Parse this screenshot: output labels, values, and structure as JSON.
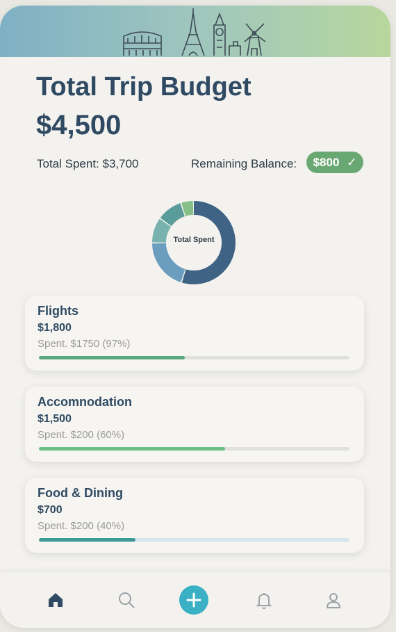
{
  "header": {
    "title": "Total Trip Budget",
    "total": "$4,500"
  },
  "summary": {
    "spent_text": "Total Spent: $3,700",
    "remaining_label": "Remaining Balance:",
    "remaining_value": "$800",
    "badge_color": "#6aa873"
  },
  "donut": {
    "label": "Total Spent",
    "segments": [
      {
        "fraction": 0.55,
        "color": "#3f6384"
      },
      {
        "fraction": 0.2,
        "color": "#6b9dbe"
      },
      {
        "fraction": 0.1,
        "color": "#78b2ae"
      },
      {
        "fraction": 0.1,
        "color": "#5a9c9a"
      },
      {
        "fraction": 0.05,
        "color": "#86bf88"
      }
    ]
  },
  "categories": [
    {
      "name": "Flights",
      "amount": "$1,800",
      "spent": "Spent. $1750 (97%)",
      "progress": 0.47,
      "color": "#5aa87e"
    },
    {
      "name": "Accomnodation",
      "amount": "$1,500",
      "spent": "Spent. $200 (60%)",
      "progress": 0.6,
      "color": "#6cbf82"
    },
    {
      "name": "Food & Dining",
      "amount": "$700",
      "spent": "Spent. $200 (40%)",
      "progress": 0.31,
      "color": "#3e9a94"
    }
  ],
  "nav": {
    "items": [
      "home-icon",
      "search-icon",
      "add-icon",
      "bell-icon",
      "user-icon"
    ],
    "active_color": "#2f4a62",
    "inactive_color": "#9aa3a8",
    "fab_color": "#3ab0c5"
  }
}
